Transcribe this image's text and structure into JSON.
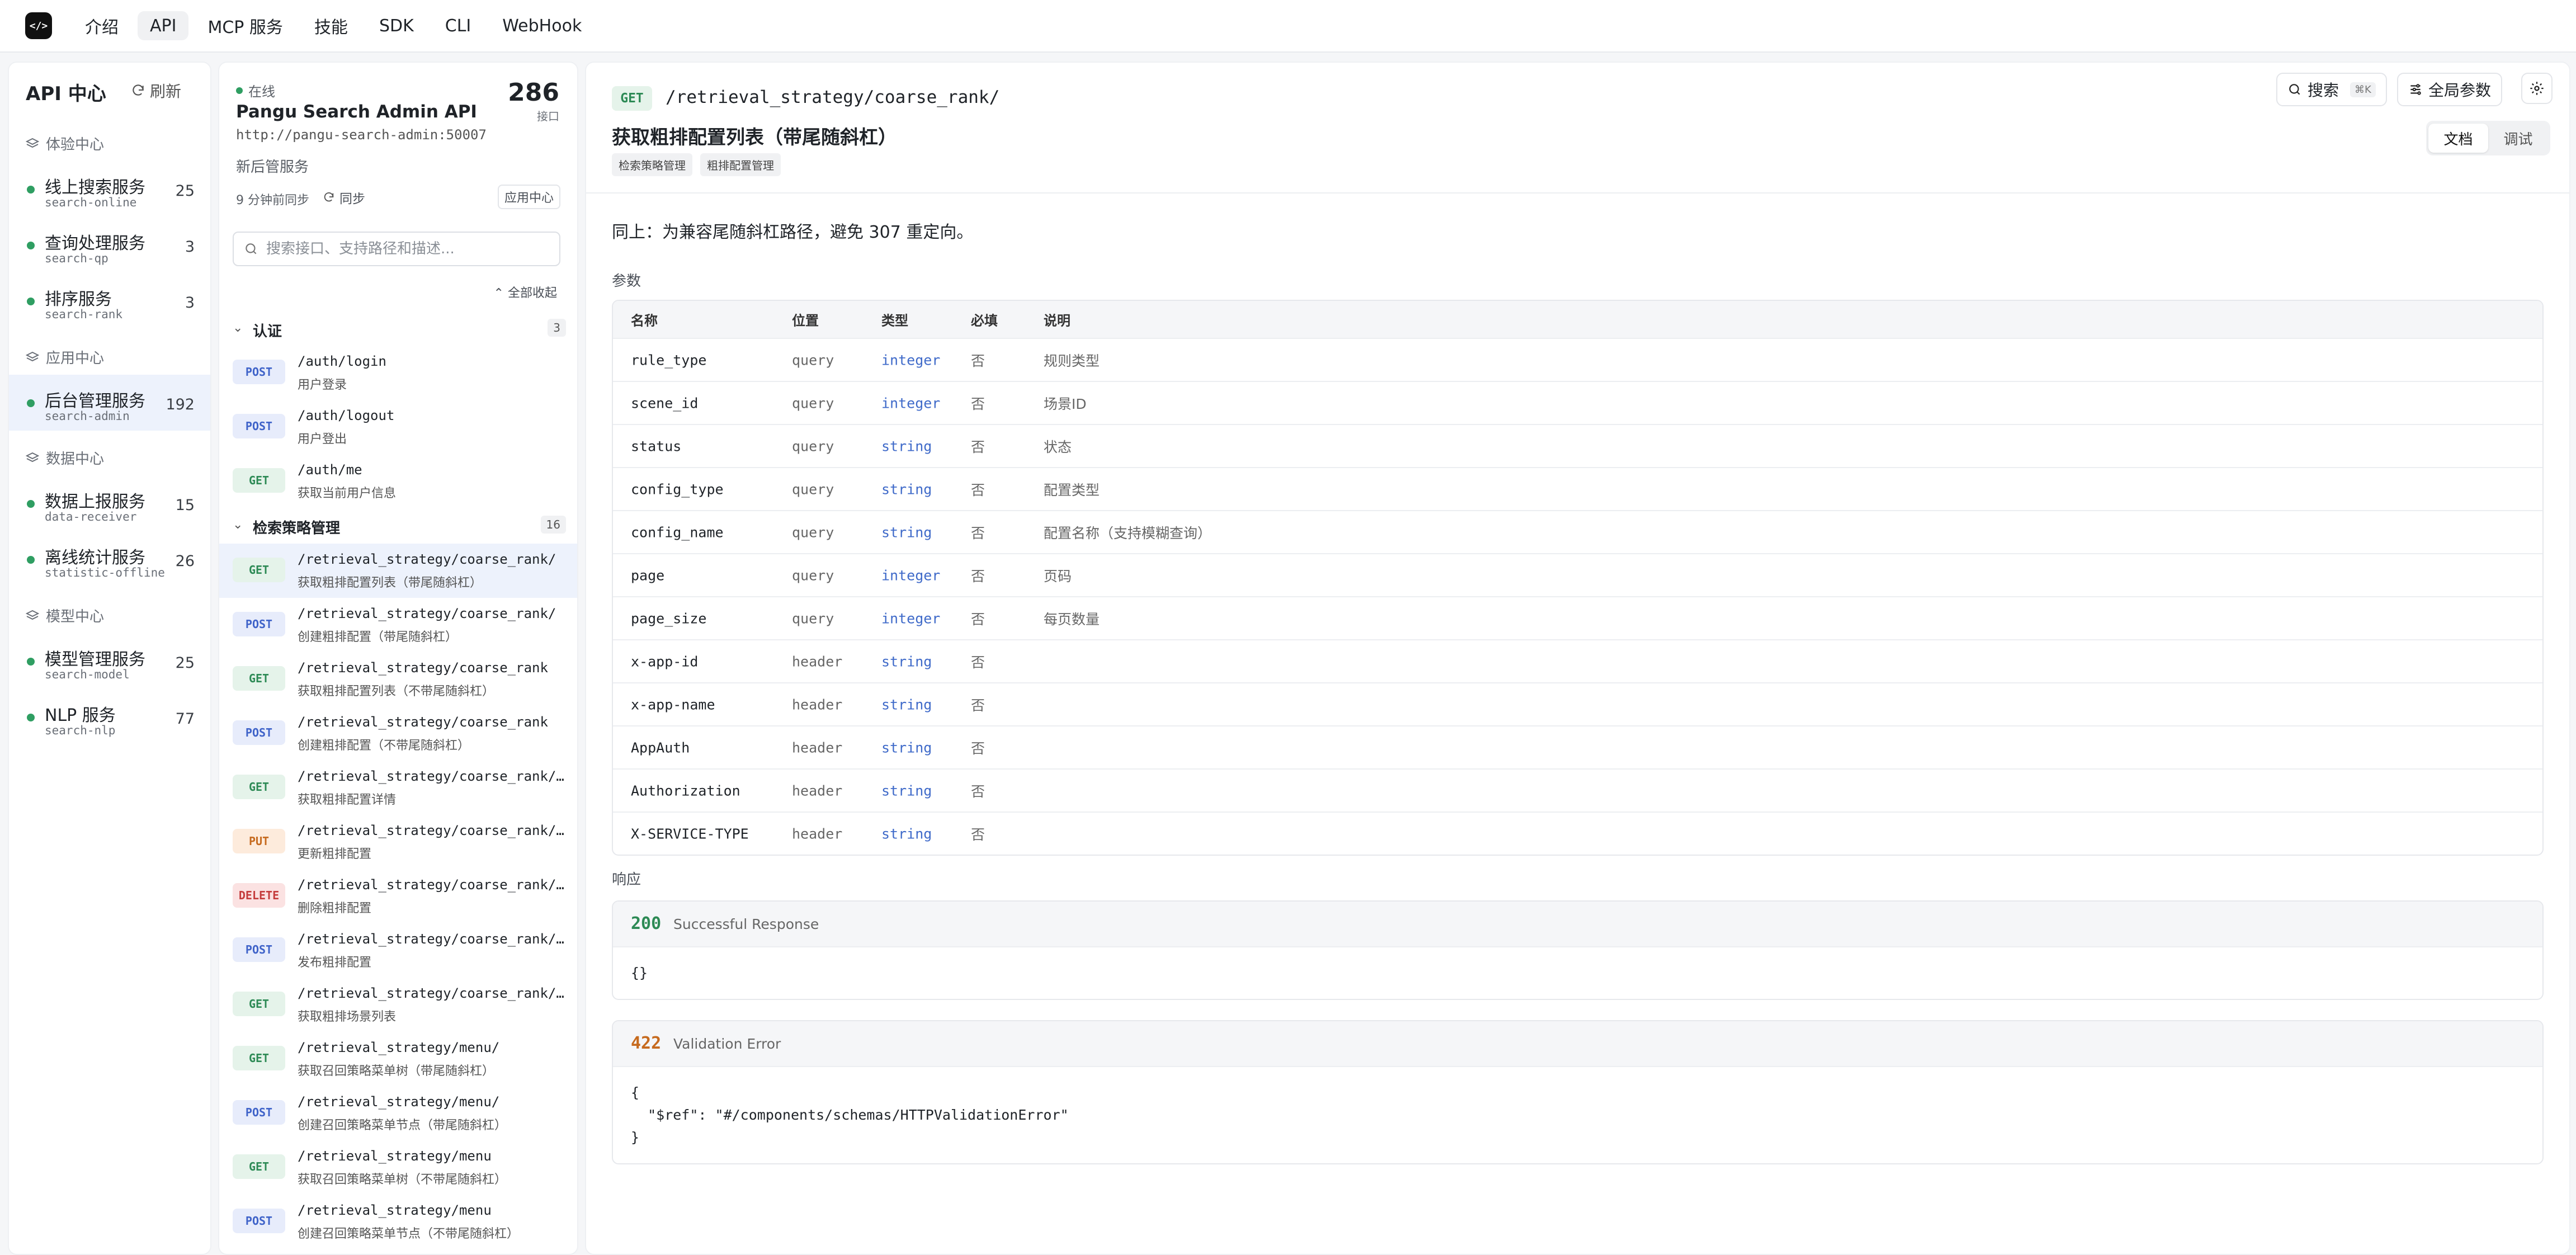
{
  "topnav": {
    "logo_text": "</>",
    "tabs": [
      {
        "label": "介绍"
      },
      {
        "label": "API"
      },
      {
        "label": "MCP 服务"
      },
      {
        "label": "技能"
      },
      {
        "label": "SDK"
      },
      {
        "label": "CLI"
      },
      {
        "label": "WebHook"
      }
    ],
    "active_tab": "API"
  },
  "sidebar": {
    "title": "API 中心",
    "refresh_label": "刷新",
    "groups": [
      {
        "label": "体验中心"
      },
      {
        "label": "应用中心"
      },
      {
        "label": "数据中心"
      },
      {
        "label": "模型中心"
      }
    ],
    "services": [
      {
        "name": "线上搜索服务",
        "id": "search-online",
        "count": "25"
      },
      {
        "name": "查询处理服务",
        "id": "search-qp",
        "count": "3"
      },
      {
        "name": "排序服务",
        "id": "search-rank",
        "count": "3"
      },
      {
        "name": "后台管理服务",
        "id": "search-admin",
        "count": "192"
      },
      {
        "name": "数据上报服务",
        "id": "data-receiver",
        "count": "15"
      },
      {
        "name": "离线统计服务",
        "id": "statistic-offline",
        "count": "26"
      },
      {
        "name": "模型管理服务",
        "id": "search-model",
        "count": "25"
      },
      {
        "name": "NLP 服务",
        "id": "search-nlp",
        "count": "77"
      }
    ],
    "status_color": "#2f9e62"
  },
  "service": {
    "status": "在线",
    "title": "Pangu Search Admin API",
    "url": "http://pangu-search-admin:50007",
    "count": "286",
    "count_label": "接口",
    "desc": "新后管服务",
    "sync_time": "9 分钟前同步",
    "sync_button": "同步",
    "app_center": "应用中心"
  },
  "search": {
    "placeholder": "搜索接口、支持路径和描述..."
  },
  "collapse_all": "全部收起",
  "api_groups": [
    {
      "name": "认证",
      "count": "3"
    },
    {
      "name": "检索策略管理",
      "count": "16"
    }
  ],
  "endpoints": [
    {
      "method": "POST",
      "path": "/auth/login",
      "desc": "用户登录"
    },
    {
      "method": "POST",
      "path": "/auth/logout",
      "desc": "用户登出"
    },
    {
      "method": "GET",
      "path": "/auth/me",
      "desc": "获取当前用户信息"
    },
    {
      "method": "GET",
      "path": "/retrieval_strategy/coarse_rank/",
      "desc": "获取粗排配置列表（带尾随斜杠）"
    },
    {
      "method": "POST",
      "path": "/retrieval_strategy/coarse_rank/",
      "desc": "创建粗排配置（带尾随斜杠）"
    },
    {
      "method": "GET",
      "path": "/retrieval_strategy/coarse_rank",
      "desc": "获取粗排配置列表（不带尾随斜杠）"
    },
    {
      "method": "POST",
      "path": "/retrieval_strategy/coarse_rank",
      "desc": "创建粗排配置（不带尾随斜杠）"
    },
    {
      "method": "GET",
      "path": "/retrieval_strategy/coarse_rank/{i…",
      "desc": "获取粗排配置详情"
    },
    {
      "method": "PUT",
      "path": "/retrieval_strategy/coarse_rank/{i…",
      "desc": "更新粗排配置"
    },
    {
      "method": "DELETE",
      "path": "/retrieval_strategy/coarse_rank/{i…",
      "desc": "删除粗排配置"
    },
    {
      "method": "POST",
      "path": "/retrieval_strategy/coarse_rank/{i…",
      "desc": "发布粗排配置"
    },
    {
      "method": "GET",
      "path": "/retrieval_strategy/coarse_rank/sc…",
      "desc": "获取粗排场景列表"
    },
    {
      "method": "GET",
      "path": "/retrieval_strategy/menu/",
      "desc": "获取召回策略菜单树（带尾随斜杠）"
    },
    {
      "method": "POST",
      "path": "/retrieval_strategy/menu/",
      "desc": "创建召回策略菜单节点（带尾随斜杠）"
    },
    {
      "method": "GET",
      "path": "/retrieval_strategy/menu",
      "desc": "获取召回策略菜单树（不带尾随斜杠）"
    },
    {
      "method": "POST",
      "path": "/retrieval_strategy/menu",
      "desc": "创建召回策略菜单节点（不带尾随斜杠）"
    }
  ],
  "detail": {
    "method": "GET",
    "path": "/retrieval_strategy/coarse_rank/",
    "title": "获取粗排配置列表（带尾随斜杠）",
    "tags": [
      "检索策略管理",
      "粗排配置管理"
    ],
    "search_label": "搜索",
    "search_kbd": "⌘K",
    "global_params_label": "全局参数",
    "view_tabs": [
      "文档",
      "调试"
    ],
    "description": "同上：为兼容尾随斜杠路径，避免 307 重定向。",
    "params_label": "参数",
    "param_headers": [
      "名称",
      "位置",
      "类型",
      "必填",
      "说明"
    ],
    "params": [
      {
        "name": "rule_type",
        "in": "query",
        "type": "integer",
        "required": "否",
        "desc": "规则类型"
      },
      {
        "name": "scene_id",
        "in": "query",
        "type": "integer",
        "required": "否",
        "desc": "场景ID"
      },
      {
        "name": "status",
        "in": "query",
        "type": "string",
        "required": "否",
        "desc": "状态"
      },
      {
        "name": "config_type",
        "in": "query",
        "type": "string",
        "required": "否",
        "desc": "配置类型"
      },
      {
        "name": "config_name",
        "in": "query",
        "type": "string",
        "required": "否",
        "desc": "配置名称（支持模糊查询）"
      },
      {
        "name": "page",
        "in": "query",
        "type": "integer",
        "required": "否",
        "desc": "页码"
      },
      {
        "name": "page_size",
        "in": "query",
        "type": "integer",
        "required": "否",
        "desc": "每页数量"
      },
      {
        "name": "x-app-id",
        "in": "header",
        "type": "string",
        "required": "否",
        "desc": ""
      },
      {
        "name": "x-app-name",
        "in": "header",
        "type": "string",
        "required": "否",
        "desc": ""
      },
      {
        "name": "AppAuth",
        "in": "header",
        "type": "string",
        "required": "否",
        "desc": ""
      },
      {
        "name": "Authorization",
        "in": "header",
        "type": "string",
        "required": "否",
        "desc": ""
      },
      {
        "name": "X-SERVICE-TYPE",
        "in": "header",
        "type": "string",
        "required": "否",
        "desc": ""
      }
    ],
    "responses_label": "响应",
    "responses": [
      {
        "code": "200",
        "label": "Successful Response",
        "body": "{}",
        "color": "#2d8a55"
      },
      {
        "code": "422",
        "label": "Validation Error",
        "body": "{\n  \"$ref\": \"#/components/schemas/HTTPValidationError\"\n}",
        "color": "#c66a1e"
      }
    ]
  }
}
